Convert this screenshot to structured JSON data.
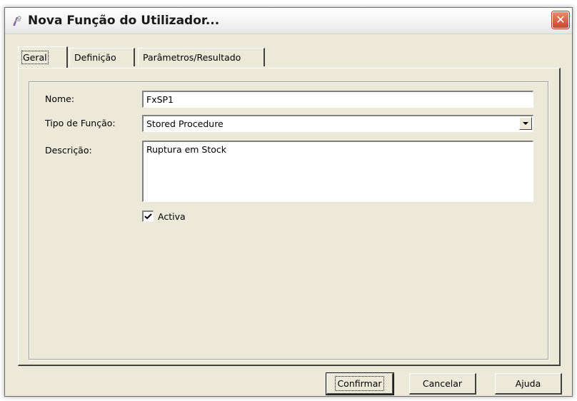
{
  "window": {
    "title": "Nova Função do Utilizador...",
    "close_glyph": "✕"
  },
  "tabs": [
    {
      "label": "Geral",
      "active": true
    },
    {
      "label": "Definição",
      "active": false
    },
    {
      "label": "Parâmetros/Resultado",
      "active": false
    }
  ],
  "form": {
    "nome_label": "Nome:",
    "nome_value": "FxSP1",
    "tipo_label": "Tipo de Função:",
    "tipo_value": "Stored Procedure",
    "descricao_label": "Descrição:",
    "descricao_value": "Ruptura em Stock",
    "activa_label": "Activa",
    "activa_checked": true
  },
  "buttons": {
    "confirmar": "Confirmar",
    "cancelar": "Cancelar",
    "ajuda": "Ajuda"
  },
  "icons": {
    "app": "function-icon",
    "close": "close-icon",
    "dropdown": "chevron-down-icon",
    "check": "checkmark-icon"
  }
}
